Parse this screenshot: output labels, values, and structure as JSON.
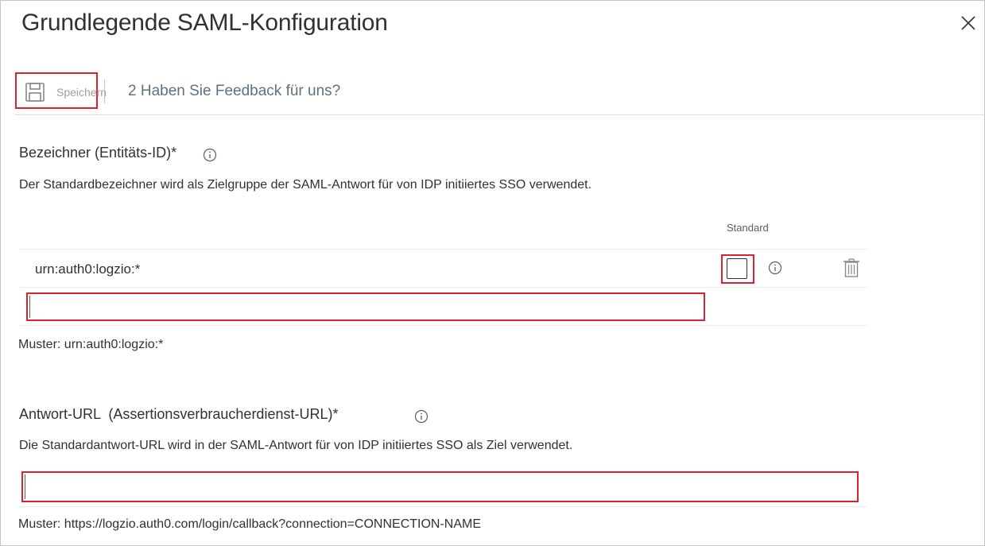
{
  "dialog": {
    "title": "Grundlegende SAML-Konfiguration"
  },
  "toolbar": {
    "save_label": "Speichern",
    "feedback_label": "2 Haben Sie Feedback für uns?"
  },
  "identifier": {
    "label": "Bezeichner (Entitäts-ID)*",
    "description": "Der Standardbezeichner wird als Zielgruppe der SAML-Antwort für von IDP initiiertes SSO verwendet.",
    "column_header": "Standard",
    "rows": [
      {
        "value": "urn:auth0:logzio:*",
        "default_checked": false
      }
    ],
    "new_value": "",
    "pattern": "Muster: urn:auth0:logzio:*"
  },
  "reply_url": {
    "label": "Antwort-URL  (Assertionsverbraucherdienst-URL)*",
    "description": "Die Standardantwort-URL wird in der SAML-Antwort für von IDP initiiertes SSO als Ziel verwendet.",
    "value": "",
    "pattern": "Muster: https://logzio.auth0.com/login/callback?connection=CONNECTION-NAME"
  },
  "colors": {
    "highlight": "#d9232e",
    "link": "#5f7181",
    "text": "#323130"
  },
  "icons": [
    "close-icon",
    "save-icon",
    "info-icon",
    "trash-icon"
  ]
}
